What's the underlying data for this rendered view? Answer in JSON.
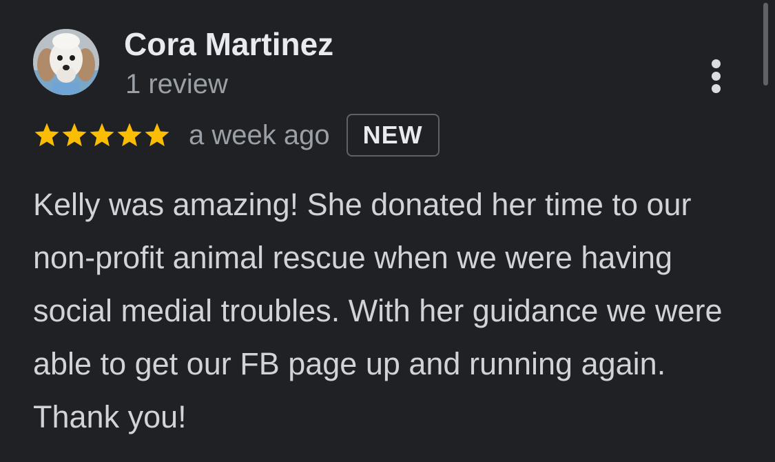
{
  "review": {
    "reviewer_name": "Cora Martinez",
    "review_count": "1 review",
    "rating": 5,
    "rating_max": 5,
    "time_ago": "a week ago",
    "badge": "NEW",
    "text": "Kelly was amazing! She donated her time to our non-profit animal rescue when we were having social medial troubles. With her guidance we were able to get our FB page up and running again. Thank you!"
  },
  "icons": {
    "more": "more-vertical-icon",
    "star": "star-icon",
    "avatar": "poodle-avatar"
  },
  "colors": {
    "background": "#202124",
    "star": "#fbbc04",
    "name": "#e8eaed",
    "secondary": "#9aa0a6",
    "body_text": "#d1d3d6",
    "badge_border": "#5f6368"
  }
}
